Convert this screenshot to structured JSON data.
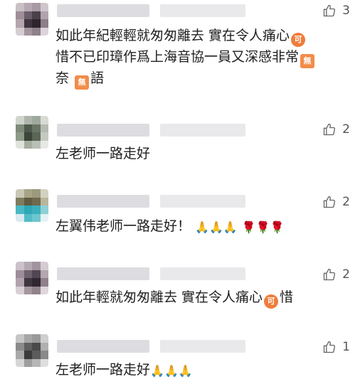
{
  "comments": [
    {
      "likes": "3",
      "text_lines": [
        "如此年紀輕輕就匆匆離去 實在令人痛心",
        "惜不已印璋作爲上海音協一員又深感非常",
        "奈",
        "語"
      ],
      "emoji_ke": "可",
      "emoji_wu": "無"
    },
    {
      "likes": "2",
      "text": "左老师一路走好"
    },
    {
      "likes": "2",
      "text": "左翼伟老师一路走好！",
      "emoji_pray": "🙏",
      "emoji_rose": "🌹"
    },
    {
      "likes": "2",
      "text_before": "如此年輕就匆匆離去 實在令人痛心",
      "emoji_ke": "可",
      "text_after": "惜"
    },
    {
      "likes": "1",
      "text": "左老师一路走好",
      "emoji_pray": "🙏"
    }
  ]
}
